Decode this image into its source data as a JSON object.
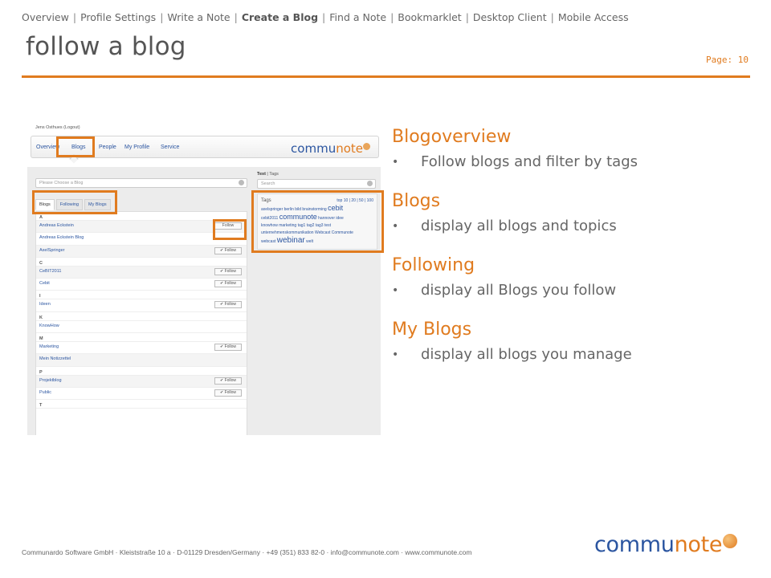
{
  "nav": {
    "items": [
      "Overview",
      "Profile Settings",
      "Write a Note",
      "Create a Blog",
      "Find a Note",
      "Bookmarklet",
      "Desktop Client",
      "Mobile Access"
    ],
    "active": "Create a Blog"
  },
  "title": "follow a blog",
  "page": "Page: 10",
  "accent_color": "#e07b1f",
  "link_color": "#2b55a0",
  "screenshot": {
    "user": "Jens Osthues (Logout)",
    "nav_items": [
      "Overview",
      "Blogs",
      "People",
      "My Profile",
      "Service"
    ],
    "brand_a": "commu",
    "brand_b": "note",
    "choose_placeholder": "Please Choose a Blog",
    "tabs": [
      "Blogs",
      "Following",
      "My Blogs"
    ],
    "rows": [
      {
        "type": "letter",
        "label": "A"
      },
      {
        "type": "blog",
        "label": "Andreas Eckstein",
        "btn": "Follow"
      },
      {
        "type": "blog",
        "label": "Andreas Eckstein Blog",
        "btn": ""
      },
      {
        "type": "blog",
        "label": "AxelSpringer",
        "btn": "✔ Follow"
      },
      {
        "type": "letter",
        "label": "C"
      },
      {
        "type": "blog",
        "label": "CeBIT2011",
        "btn": "✔ Follow"
      },
      {
        "type": "blog",
        "label": "Cebit",
        "btn": "✔ Follow"
      },
      {
        "type": "letter",
        "label": "I"
      },
      {
        "type": "blog",
        "label": "Ideen",
        "btn": "✔ Follow"
      },
      {
        "type": "letter",
        "label": "K"
      },
      {
        "type": "blog",
        "label": "KnowHow",
        "btn": ""
      },
      {
        "type": "letter",
        "label": "M"
      },
      {
        "type": "blog",
        "label": "Marketing",
        "btn": "✔ Follow"
      },
      {
        "type": "blog",
        "label": "Mein Notizzettel",
        "btn": ""
      },
      {
        "type": "letter",
        "label": "P"
      },
      {
        "type": "blog",
        "label": "Projektblog",
        "btn": "✔ Follow"
      },
      {
        "type": "blog",
        "label": "Public",
        "btn": "✔ Follow"
      },
      {
        "type": "letter",
        "label": "T"
      }
    ],
    "text_label": "Text",
    "tags_label": "Tags",
    "search_placeholder": "Search",
    "tag_header": "Tags",
    "tag_top": "top  10 | 20 | 50 | 100",
    "tag_line1": "axelspringer  berlin  bild  brainstorming",
    "tag_big1": "cebit",
    "tag_line2": "cebit2011",
    "tag_big2": "communote",
    "tag_line2b": "hannover  idee",
    "tag_line3": "knowhow  marketing  tag1  tag2  tag3  test",
    "tag_line4": "unternehmenskommunikation  Webcast Communote",
    "tag_line5": "webcast",
    "tag_big3": "webinar",
    "tag_line5b": "welt"
  },
  "sections": [
    {
      "heading": "Blogoverview",
      "bullet": "Follow blogs and filter by tags"
    },
    {
      "heading": "Blogs",
      "bullet": "display all blogs and topics"
    },
    {
      "heading": "Following",
      "bullet": "display all Blogs you follow"
    },
    {
      "heading": "My Blogs",
      "bullet": "display all blogs you manage"
    }
  ],
  "footer": "Communardo Software GmbH · Kleiststraße 10 a · D-01129 Dresden/Germany · +49 (351) 833 82-0 · info@communote.com · www.communote.com",
  "logo": {
    "a": "commu",
    "b": "note"
  }
}
